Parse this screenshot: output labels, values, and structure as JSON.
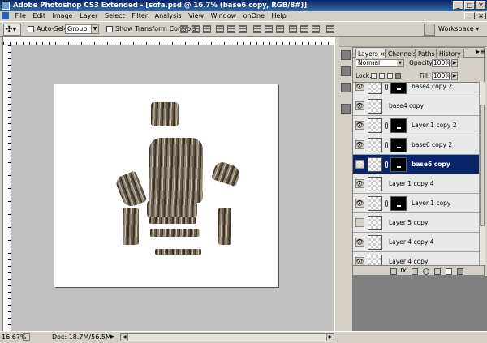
{
  "window": {
    "title": "Adobe Photoshop CS3 Extended - [sofa.psd @ 16.7% (base6 copy, RGB/8#)]",
    "controls": [
      "_",
      "□",
      "✕"
    ]
  },
  "menubar": {
    "items": [
      "File",
      "Edit",
      "Image",
      "Layer",
      "Select",
      "Filter",
      "Analysis",
      "View",
      "Window",
      "onOne",
      "Help"
    ]
  },
  "options": {
    "auto_select_label": "Auto-Select:",
    "auto_select_value": "Group",
    "show_transform_label": "Show Transform Controls",
    "workspace_label": "Workspace ▾"
  },
  "status": {
    "zoom": "16.67%",
    "doc": "Doc: 18.7M/56.5M"
  },
  "layers_panel": {
    "tabs": [
      "Layers ×",
      "Channels",
      "Paths",
      "History"
    ],
    "blend_mode": "Normal",
    "opacity_label": "Opacity:",
    "opacity_value": "100%",
    "lock_label": "Lock:",
    "fill_label": "Fill:",
    "fill_value": "100%",
    "layers": [
      {
        "name": "base4 copy 2",
        "visible": true,
        "mask": true,
        "selected": false
      },
      {
        "name": "base4 copy",
        "visible": true,
        "mask": false,
        "selected": false
      },
      {
        "name": "Layer 1 copy 2",
        "visible": true,
        "mask": true,
        "selected": false
      },
      {
        "name": "base6 copy 2",
        "visible": true,
        "mask": true,
        "selected": false
      },
      {
        "name": "base6 copy",
        "visible": true,
        "mask": true,
        "selected": true
      },
      {
        "name": "Layer 1 copy 4",
        "visible": true,
        "mask": false,
        "selected": false
      },
      {
        "name": "Layer 1 copy",
        "visible": true,
        "mask": true,
        "selected": false
      },
      {
        "name": "Layer 5 copy",
        "visible": false,
        "mask": false,
        "selected": false
      },
      {
        "name": "Layer 4 copy 4",
        "visible": true,
        "mask": false,
        "selected": false
      },
      {
        "name": "Layer 4 copy",
        "visible": true,
        "mask": false,
        "selected": false
      }
    ]
  },
  "colors": {
    "titlebar": "#0a246a",
    "selected_layer": "#0a246a",
    "workspace": "#c0c0c0",
    "panel": "#d4d0c8"
  }
}
